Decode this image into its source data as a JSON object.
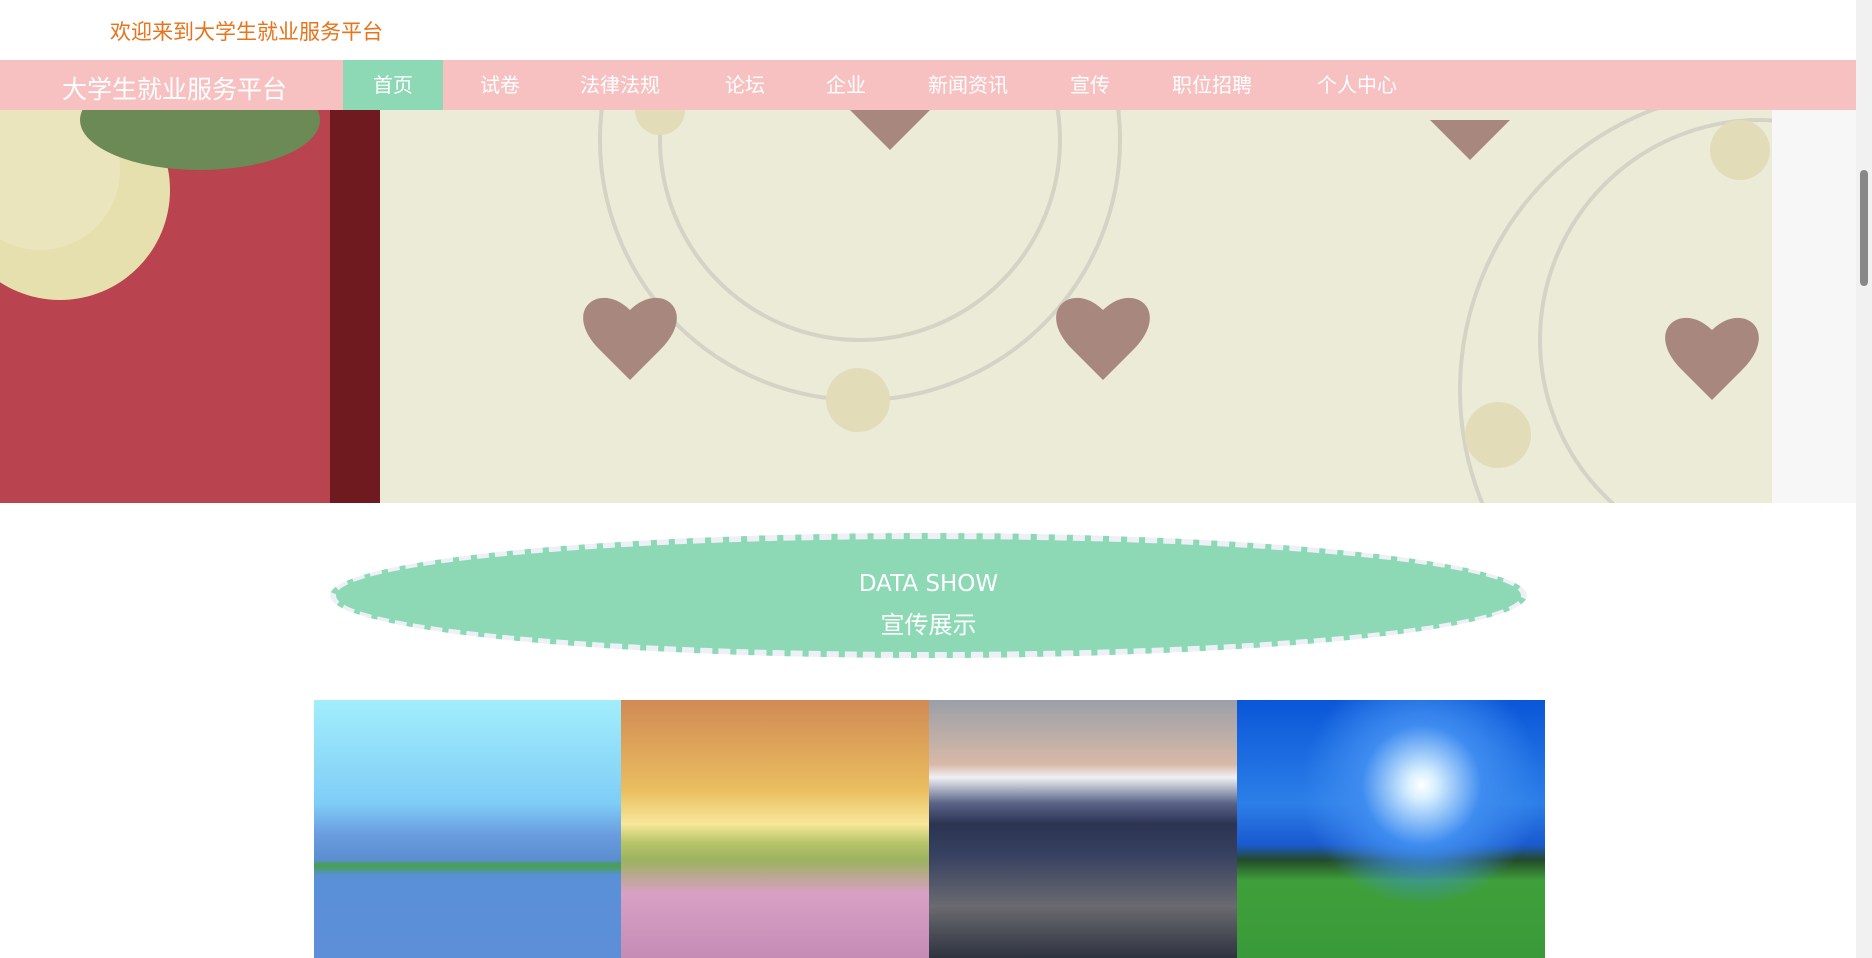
{
  "header": {
    "welcome": "欢迎来到大学生就业服务平台"
  },
  "nav": {
    "brand": "大学生就业服务平台",
    "items": [
      {
        "label": "首页",
        "active": true
      },
      {
        "label": "试卷"
      },
      {
        "label": "法律法规"
      },
      {
        "label": "论坛"
      },
      {
        "label": "企业"
      },
      {
        "label": "新闻资讯"
      },
      {
        "label": "宣传"
      },
      {
        "label": "职位招聘"
      },
      {
        "label": "个人中心"
      }
    ]
  },
  "carousel": {
    "slides": 3,
    "active_index": 0,
    "colors": {
      "active": "#f7c1c2",
      "inactive": "#f7f7f7"
    }
  },
  "section": {
    "title_en": "DATA SHOW",
    "title_cn": "宣传展示"
  },
  "gallery": {
    "images": [
      "lake-mountains",
      "sunset-flower-field",
      "mount-fuji-city",
      "moonlit-meadow"
    ]
  },
  "colors": {
    "accent": "#8dd9b6",
    "nav_bg": "#f7c1c2",
    "welcome": "#e8731a"
  }
}
